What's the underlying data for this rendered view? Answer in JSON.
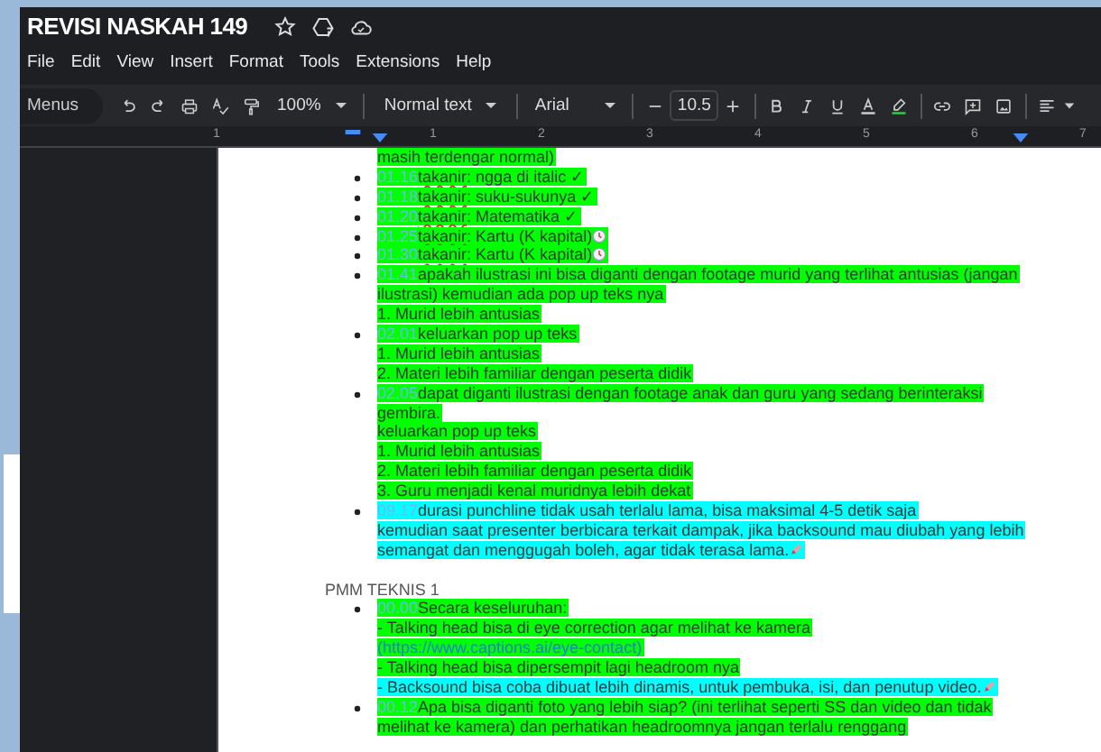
{
  "window": {
    "title": "REVISI NASKAH 149"
  },
  "menu": [
    "File",
    "Edit",
    "View",
    "Insert",
    "Format",
    "Tools",
    "Extensions",
    "Help"
  ],
  "toolbar": {
    "menus_label": "Menus",
    "zoom": "100%",
    "style": "Normal text",
    "font": "Arial",
    "font_size": "10.5"
  },
  "ruler": {
    "labels": [
      "1",
      "1",
      "2",
      "3",
      "4",
      "5",
      "6",
      "7"
    ]
  },
  "document": {
    "lines": [
      {
        "kind": "text",
        "bullet": false,
        "color": "#00ff00",
        "parts": [
          {
            "kind": "plain",
            "text": "masih terdengar normal)"
          }
        ]
      },
      {
        "kind": "text",
        "bullet": true,
        "color": "#00ff00",
        "timestamp": "01.16",
        "parts": [
          {
            "kind": "misspelled",
            "text": "takanir"
          },
          {
            "kind": "plain",
            "text": ": ngga di italic ✓"
          }
        ]
      },
      {
        "kind": "text",
        "bullet": true,
        "color": "#00ff00",
        "timestamp": "01.18",
        "parts": [
          {
            "kind": "misspelled",
            "text": "takanir"
          },
          {
            "kind": "plain",
            "text": ": suku-sukunya ✓"
          }
        ]
      },
      {
        "kind": "text",
        "bullet": true,
        "color": "#00ff00",
        "timestamp": "01.20",
        "parts": [
          {
            "kind": "misspelled",
            "text": "takanir"
          },
          {
            "kind": "plain",
            "text": ": Matematika ✓"
          }
        ]
      },
      {
        "kind": "text",
        "bullet": true,
        "color": "#00ff00",
        "timestamp": "01.25",
        "parts": [
          {
            "kind": "misspelled",
            "text": "takanir"
          },
          {
            "kind": "plain",
            "text": ": Kartu (K kapital)"
          },
          {
            "kind": "clock"
          }
        ]
      },
      {
        "kind": "text",
        "bullet": true,
        "color": "#00ff00",
        "timestamp": "01.30",
        "parts": [
          {
            "kind": "misspelled",
            "text": "takanir"
          },
          {
            "kind": "plain",
            "text": ": Kartu (K kapital)"
          },
          {
            "kind": "clock"
          }
        ]
      },
      {
        "kind": "text",
        "bullet": true,
        "color": "#00ff00",
        "timestamp": "01.41",
        "parts": [
          {
            "kind": "plain",
            "text": "apakah ilustrasi ini bisa diganti dengan footage murid yang terlihat antusias (jangan"
          }
        ]
      },
      {
        "kind": "text",
        "bullet": false,
        "color": "#00ff00",
        "parts": [
          {
            "kind": "plain",
            "text": "ilustrasi) kemudian ada pop up teks nya"
          }
        ]
      },
      {
        "kind": "text",
        "bullet": false,
        "color": "#00ff00",
        "parts": [
          {
            "kind": "plain",
            "text": "1. Murid lebih antusias"
          }
        ]
      },
      {
        "kind": "text",
        "bullet": true,
        "color": "#00ff00",
        "timestamp": "02.01",
        "parts": [
          {
            "kind": "plain",
            "text": "keluarkan pop up teks"
          }
        ]
      },
      {
        "kind": "text",
        "bullet": false,
        "color": "#00ff00",
        "parts": [
          {
            "kind": "plain",
            "text": "1. Murid lebih antusias"
          }
        ]
      },
      {
        "kind": "text",
        "bullet": false,
        "color": "#00ff00",
        "parts": [
          {
            "kind": "plain",
            "text": "2. Materi lebih familiar dengan peserta didik"
          }
        ]
      },
      {
        "kind": "text",
        "bullet": true,
        "color": "#00ff00",
        "timestamp": "02.05",
        "parts": [
          {
            "kind": "plain",
            "text": "dapat diganti ilustrasi dengan footage anak dan guru yang sedang berinteraksi"
          }
        ]
      },
      {
        "kind": "text",
        "bullet": false,
        "color": "#00ff00",
        "parts": [
          {
            "kind": "plain",
            "text": "gembira."
          }
        ]
      },
      {
        "kind": "text",
        "bullet": false,
        "color": "#00ff00",
        "parts": [
          {
            "kind": "plain",
            "text": "keluarkan pop up teks"
          }
        ]
      },
      {
        "kind": "text",
        "bullet": false,
        "color": "#00ff00",
        "parts": [
          {
            "kind": "plain",
            "text": "1. Murid lebih antusias"
          }
        ]
      },
      {
        "kind": "text",
        "bullet": false,
        "color": "#00ff00",
        "parts": [
          {
            "kind": "plain",
            "text": "2. Materi lebih familiar dengan peserta didik"
          }
        ]
      },
      {
        "kind": "text",
        "bullet": false,
        "color": "#00ff00",
        "parts": [
          {
            "kind": "plain",
            "text": "3. Guru menjadi kenal muridnya lebih dekat"
          }
        ]
      },
      {
        "kind": "text",
        "bullet": true,
        "color": "#00ffff",
        "timestamp": "09.17",
        "parts": [
          {
            "kind": "plain",
            "text": "durasi punchline tidak usah terlalu lama, bisa maksimal 4-5 detik saja"
          }
        ]
      },
      {
        "kind": "text",
        "bullet": false,
        "color": "#00ffff",
        "parts": [
          {
            "kind": "plain",
            "text": "kemudian saat presenter berbicara terkait dampak, jika backsound mau diubah yang lebih"
          }
        ]
      },
      {
        "kind": "text",
        "bullet": false,
        "color": "#00ffff",
        "parts": [
          {
            "kind": "plain",
            "text": "semangat dan menggugah boleh, agar tidak terasa lama."
          },
          {
            "kind": "pencil"
          }
        ]
      },
      {
        "kind": "blank",
        "bullet": false
      },
      {
        "kind": "heading",
        "bullet": false,
        "parts": [
          {
            "kind": "plain",
            "text": "PMM TEKNIS 1"
          }
        ]
      },
      {
        "kind": "text",
        "bullet": true,
        "color": "#00ff00",
        "timestamp": "00.00",
        "parts": [
          {
            "kind": "plain",
            "text": "Secara keseluruhan:"
          }
        ]
      },
      {
        "kind": "text",
        "bullet": false,
        "color": "#00ff00",
        "parts": [
          {
            "kind": "plain",
            "text": "- Talking head bisa di eye correction agar melihat ke kamera"
          }
        ]
      },
      {
        "kind": "text",
        "bullet": false,
        "color": "#00ff00",
        "parts": [
          {
            "kind": "link",
            "text": "(https://www.captions.ai/eye-contact)"
          }
        ]
      },
      {
        "kind": "text",
        "bullet": false,
        "color": "#00ff00",
        "parts": [
          {
            "kind": "plain",
            "text": "- Talking head bisa dipersempit lagi headroom nya"
          }
        ]
      },
      {
        "kind": "text",
        "bullet": false,
        "color": "#00ffff",
        "parts": [
          {
            "kind": "plain",
            "text": "- Backsound bisa coba dibuat lebih dinamis, untuk pembuka, isi, dan penutup video."
          },
          {
            "kind": "pencil"
          }
        ]
      },
      {
        "kind": "text",
        "bullet": true,
        "color": "#00ff00",
        "timestamp": "00.12",
        "parts": [
          {
            "kind": "plain",
            "text": "Apa bisa diganti foto yang lebih siap? (ini terlihat seperti SS dan video dan tidak"
          }
        ]
      },
      {
        "kind": "text",
        "bullet": false,
        "color": "#00ff00",
        "parts": [
          {
            "kind": "plain",
            "text": "melihat ke kamera) dan perhatikan headroomnya jangan terlalu renggang"
          }
        ]
      }
    ]
  }
}
